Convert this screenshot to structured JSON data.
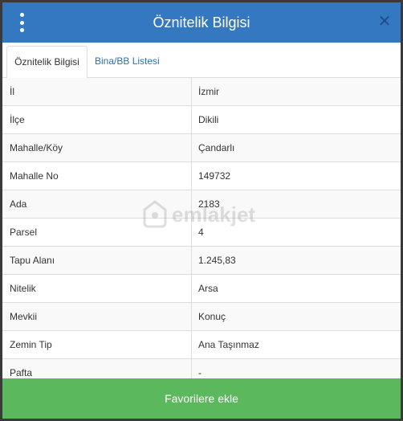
{
  "header": {
    "title": "Öznitelik Bilgisi",
    "menu_icon": "vertical-dots-icon",
    "close_icon": "close-icon",
    "color": "#3478c1"
  },
  "tabs": [
    {
      "label": "Öznitelik Bilgisi",
      "active": true
    },
    {
      "label": "Bina/BB Listesi",
      "active": false
    }
  ],
  "rows": [
    {
      "key": "İl",
      "value": "İzmir"
    },
    {
      "key": "İlçe",
      "value": "Dikili"
    },
    {
      "key": "Mahalle/Köy",
      "value": "Çandarlı"
    },
    {
      "key": "Mahalle No",
      "value": "149732"
    },
    {
      "key": "Ada",
      "value": "2183"
    },
    {
      "key": "Parsel",
      "value": "4"
    },
    {
      "key": "Tapu Alanı",
      "value": "1.245,83"
    },
    {
      "key": "Nitelik",
      "value": "Arsa"
    },
    {
      "key": "Mevkii",
      "value": "Konuç"
    },
    {
      "key": "Zemin Tip",
      "value": "Ana Taşınmaz"
    },
    {
      "key": "Pafta",
      "value": "-"
    }
  ],
  "footer": {
    "button_label": "Favorilere ekle",
    "color": "#5cb85c"
  },
  "watermark": {
    "text": "emlakjet"
  }
}
